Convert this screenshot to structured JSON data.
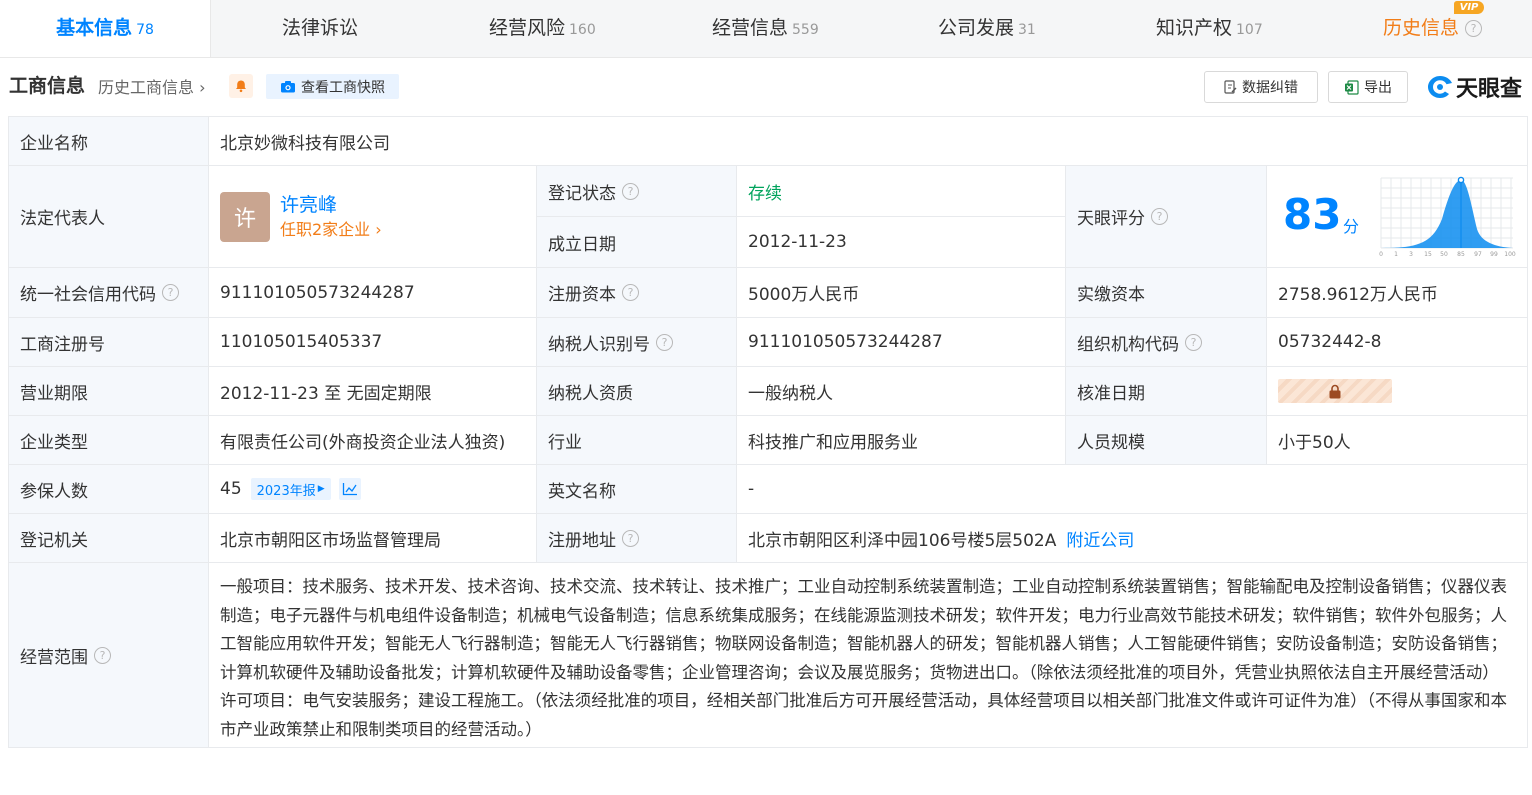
{
  "tabs": [
    {
      "label": "基本信息",
      "count": "78"
    },
    {
      "label": "法律诉讼",
      "count": ""
    },
    {
      "label": "经营风险",
      "count": "160"
    },
    {
      "label": "经营信息",
      "count": "559"
    },
    {
      "label": "公司发展",
      "count": "31"
    },
    {
      "label": "知识产权",
      "count": "107"
    },
    {
      "label": "历史信息",
      "count": "",
      "badge": "VIP"
    }
  ],
  "header": {
    "title": "工商信息",
    "history_link": "历史工商信息",
    "snapshot_label": "查看工商快照",
    "correct_label": "数据纠错",
    "export_label": "导出",
    "logo_text": "天眼查"
  },
  "info": {
    "company_name_label": "企业名称",
    "company_name": "北京妙微科技有限公司",
    "legal_rep_label": "法定代表人",
    "legal_rep_avatar": "许",
    "legal_rep_name": "许亮峰",
    "legal_rep_jobs": "任职2家企业",
    "reg_status_label": "登记状态",
    "reg_status": "存续",
    "found_date_label": "成立日期",
    "found_date": "2012-11-23",
    "score_label": "天眼评分",
    "score": "83",
    "score_unit": "分",
    "score_axis": [
      "0",
      "1",
      "3",
      "15",
      "50",
      "85",
      "97",
      "99",
      "100"
    ],
    "credit_code_label": "统一社会信用代码",
    "credit_code": "91110105057324428​7",
    "reg_capital_label": "注册资本",
    "reg_capital": "5000万人民币",
    "paid_capital_label": "实缴资本",
    "paid_capital": "2758.9612万人民币",
    "biz_reg_no_label": "工商注册号",
    "biz_reg_no": "110105015405337",
    "taxpayer_id_label": "纳税人识别号",
    "taxpayer_id": "911101050573244287",
    "org_code_label": "组织机构代码",
    "org_code": "05732442-8",
    "term_label": "营业期限",
    "term": "2012-11-23 至 无固定期限",
    "taxpayer_qual_label": "纳税人资质",
    "taxpayer_qual": "一般纳税人",
    "approve_date_label": "核准日期",
    "type_label": "企业类型",
    "type": "有限责任公司(外商投资企业法人独资)",
    "industry_label": "行业",
    "industry": "科技推广和应用服务业",
    "staff_label": "人员规模",
    "staff": "小于50人",
    "insured_label": "参保人数",
    "insured": "45",
    "insured_report": "2023年报",
    "english_name_label": "英文名称",
    "english_name": "-",
    "authority_label": "登记机关",
    "authority": "北京市朝阳区市场监督管理局",
    "address_label": "注册地址",
    "address": "北京市朝阳区利泽中园106号楼5层502A",
    "nearby_label": "附近公司",
    "scope_label": "经营范围",
    "scope": "一般项目：技术服务、技术开发、技术咨询、技术交流、技术转让、技术推广；工业自动控制系统装置制造；工业自动控制系统装置销售；智能输配电及控制设备销售；仪器仪表制造；电子元器件与机电组件设备制造；机械电气设备制造；信息系统集成服务；在线能源监测技术研发；软件开发；电力行业高效节能技术研发；软件销售；软件外包服务；人工智能应用软件开发；智能无人飞行器制造；智能无人飞行器销售；物联网设备制造；智能机器人的研发；智能机器人销售；人工智能硬件销售；安防设备制造；安防设备销售；计算机软硬件及辅助设备批发；计算机软硬件及辅助设备零售；企业管理咨询；会议及展览服务；货物进出口。（除依法须经批准的项目外，凭营业执照依法自主开展经营活动）许可项目：电气安装服务；建设工程施工。（依法须经批准的项目，经相关部门批准后方可开展经营活动，具体经营项目以相关部门批准文件或许可证件为准）（不得从事国家和本市产业政策禁止和限制类项目的经营活动。）"
  },
  "colors": {
    "accent": "#0084ff",
    "orange": "#f27d18",
    "green": "#00a35c",
    "label_bg": "#f5f8fc"
  }
}
